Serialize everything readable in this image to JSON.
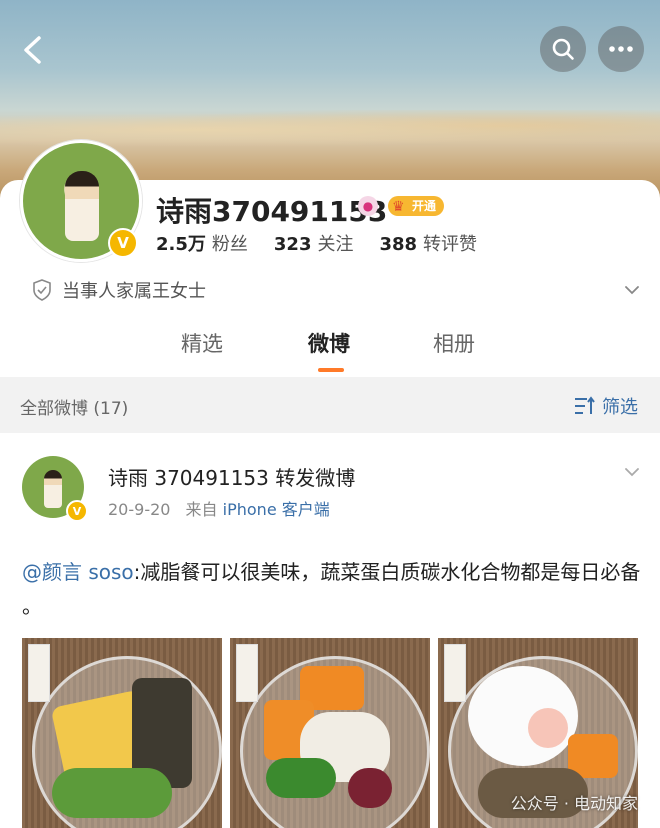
{
  "header": {
    "back_icon": "chevron-left-icon",
    "search_icon": "search-icon",
    "more_icon": "more-dots-icon"
  },
  "profile": {
    "username": "诗雨370491153",
    "badge_label": "开通",
    "stats": [
      {
        "num": "2.5万",
        "label": "粉丝"
      },
      {
        "num": "323",
        "label": "关注"
      },
      {
        "num": "388",
        "label": "转评赞"
      }
    ],
    "intro": "当事人家属王女士"
  },
  "tabs": [
    "精选",
    "微博",
    "相册"
  ],
  "active_tab": "微博",
  "filter_bar": {
    "count_label": "全部微博 (17)",
    "filter_label": "筛选"
  },
  "post": {
    "author": "诗雨 370491153 转发微博",
    "date": "20-9-20",
    "from_prefix": "来自",
    "source": "iPhone 客户端",
    "mention": "@颜言 soso",
    "text": ":减脂餐可以很美味，蔬菜蛋白质碳水化合物都是每日必备 。"
  },
  "watermark": "公众号 · 电动知家",
  "colors": {
    "accent_orange": "#ff7a29",
    "link_blue": "#3a6fa8",
    "verified_gold": "#f5b700"
  }
}
